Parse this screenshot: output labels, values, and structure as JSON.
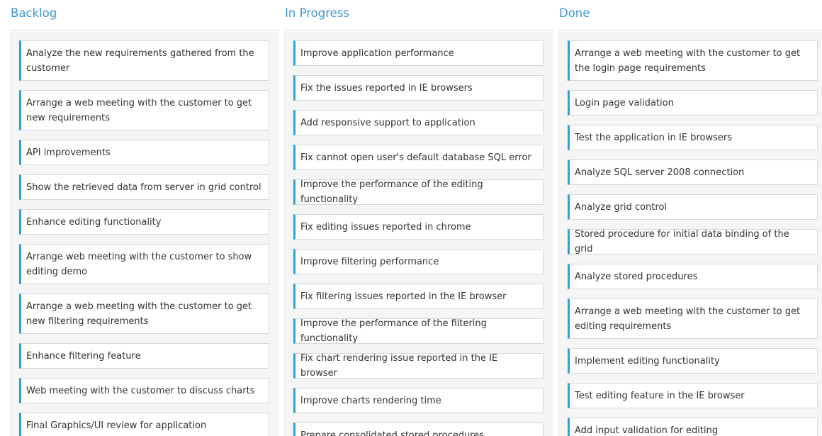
{
  "columns": [
    {
      "title": "Backlog",
      "cards": [
        "Analyze the new requirements gathered from the customer",
        "Arrange a web meeting with the customer to get new requirements",
        "API improvements",
        "Show the retrieved data from server in grid control",
        "Enhance editing functionality",
        "Arrange web meeting with the customer to show editing demo",
        "Arrange a web meeting with the customer to get new filtering requirements",
        "Enhance filtering feature",
        "Web meeting with the customer to discuss charts",
        "Final Graphics/UI review for application"
      ]
    },
    {
      "title": "In Progress",
      "cards": [
        "Improve application performance",
        "Fix the issues reported in IE browsers",
        "Add responsive support to application",
        "Fix cannot open user's default database SQL error",
        "Improve the performance of the editing functionality",
        "Fix editing issues reported in chrome",
        "Improve filtering performance",
        "Fix filtering issues reported in the IE browser",
        "Improve the performance of the filtering functionality",
        "Fix chart rendering issue reported in the IE browser",
        "Improve charts rendering time",
        "Prepare consolidated stored procedures"
      ]
    },
    {
      "title": "Done",
      "cards": [
        "Arrange a web meeting with the customer to get the login page requirements",
        "Login page validation",
        "Test the application in IE browsers",
        "Analyze SQL server 2008 connection",
        "Analyze grid control",
        "Stored procedure for initial data binding of the grid",
        "Analyze stored procedures",
        "Arrange a web meeting with the customer to get editing requirements",
        "Implement editing functionality",
        "Test editing feature in the IE browser",
        "Add input validation for editing"
      ]
    }
  ],
  "colors": {
    "header_text": "#3a97d4",
    "card_accent": "#2f9fd9",
    "column_bg": "#f5f5f5"
  }
}
